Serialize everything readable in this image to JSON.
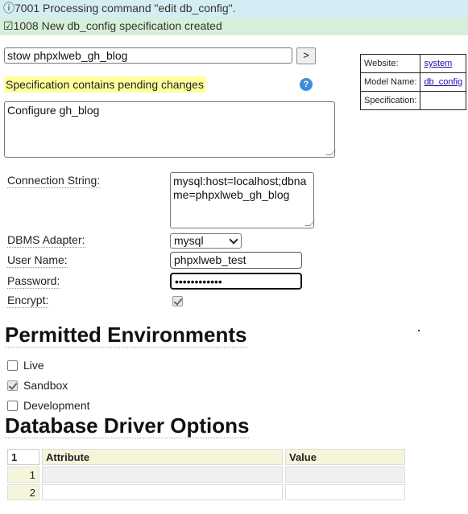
{
  "messages": [
    {
      "icon": "ⓘ",
      "text": "7001 Processing command \"edit db_config\"."
    },
    {
      "icon": "☑",
      "text": "1008 New db_config specification created"
    }
  ],
  "command": {
    "value": "stow phpxlweb_gh_blog",
    "button_label": ">"
  },
  "pending_notice": "Specification contains pending changes",
  "help_icon": "?",
  "info": {
    "website_label": "Website:",
    "website_value": "system",
    "model_label": "Model Name:",
    "model_value": "db_config",
    "spec_label": "Specification:",
    "spec_value": ""
  },
  "description": "Configure gh_blog",
  "fields": {
    "connection_label": "Connection String:",
    "connection_value": "mysql:host=localhost;dbname=phpxlweb_gh_blog",
    "adapter_label": "DBMS Adapter:",
    "adapter_value": "mysql",
    "user_label": "User Name:",
    "user_value": "phpxlweb_test",
    "password_label": "Password:",
    "password_value": "••••••••••••",
    "encrypt_label": "Encrypt:",
    "encrypt_checked": true
  },
  "environments": {
    "heading": "Permitted Environments",
    "items": [
      {
        "label": "Live",
        "checked": false
      },
      {
        "label": "Sandbox",
        "checked": true
      },
      {
        "label": "Development",
        "checked": false
      }
    ]
  },
  "driver_options": {
    "heading": "Database Driver Options",
    "count": "1",
    "columns": [
      "Attribute",
      "Value"
    ],
    "rows": [
      {
        "num": "1",
        "attribute": "",
        "value": ""
      },
      {
        "num": "2",
        "attribute": "",
        "value": ""
      }
    ]
  }
}
